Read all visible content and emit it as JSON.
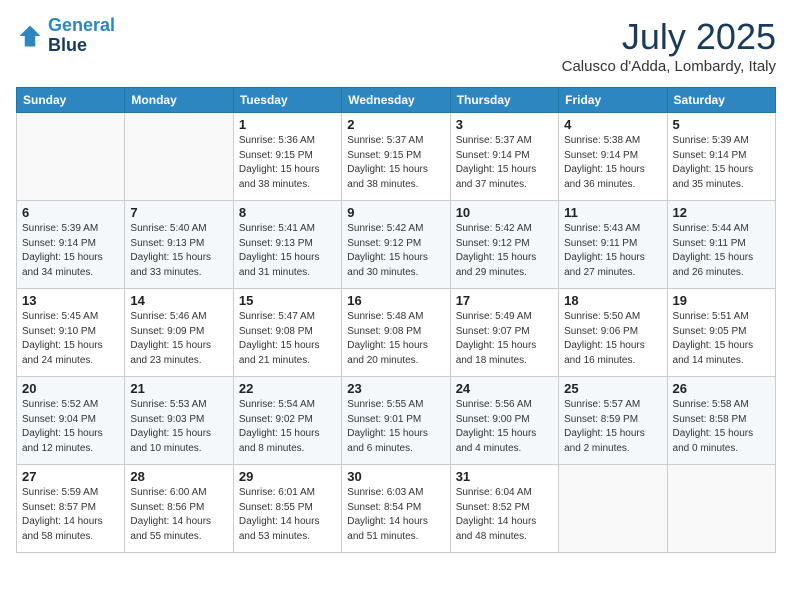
{
  "header": {
    "logo_line1": "General",
    "logo_line2": "Blue",
    "month_title": "July 2025",
    "location": "Calusco d'Adda, Lombardy, Italy"
  },
  "days_of_week": [
    "Sunday",
    "Monday",
    "Tuesday",
    "Wednesday",
    "Thursday",
    "Friday",
    "Saturday"
  ],
  "weeks": [
    [
      {
        "day": "",
        "info": ""
      },
      {
        "day": "",
        "info": ""
      },
      {
        "day": "1",
        "info": "Sunrise: 5:36 AM\nSunset: 9:15 PM\nDaylight: 15 hours\nand 38 minutes."
      },
      {
        "day": "2",
        "info": "Sunrise: 5:37 AM\nSunset: 9:15 PM\nDaylight: 15 hours\nand 38 minutes."
      },
      {
        "day": "3",
        "info": "Sunrise: 5:37 AM\nSunset: 9:14 PM\nDaylight: 15 hours\nand 37 minutes."
      },
      {
        "day": "4",
        "info": "Sunrise: 5:38 AM\nSunset: 9:14 PM\nDaylight: 15 hours\nand 36 minutes."
      },
      {
        "day": "5",
        "info": "Sunrise: 5:39 AM\nSunset: 9:14 PM\nDaylight: 15 hours\nand 35 minutes."
      }
    ],
    [
      {
        "day": "6",
        "info": "Sunrise: 5:39 AM\nSunset: 9:14 PM\nDaylight: 15 hours\nand 34 minutes."
      },
      {
        "day": "7",
        "info": "Sunrise: 5:40 AM\nSunset: 9:13 PM\nDaylight: 15 hours\nand 33 minutes."
      },
      {
        "day": "8",
        "info": "Sunrise: 5:41 AM\nSunset: 9:13 PM\nDaylight: 15 hours\nand 31 minutes."
      },
      {
        "day": "9",
        "info": "Sunrise: 5:42 AM\nSunset: 9:12 PM\nDaylight: 15 hours\nand 30 minutes."
      },
      {
        "day": "10",
        "info": "Sunrise: 5:42 AM\nSunset: 9:12 PM\nDaylight: 15 hours\nand 29 minutes."
      },
      {
        "day": "11",
        "info": "Sunrise: 5:43 AM\nSunset: 9:11 PM\nDaylight: 15 hours\nand 27 minutes."
      },
      {
        "day": "12",
        "info": "Sunrise: 5:44 AM\nSunset: 9:11 PM\nDaylight: 15 hours\nand 26 minutes."
      }
    ],
    [
      {
        "day": "13",
        "info": "Sunrise: 5:45 AM\nSunset: 9:10 PM\nDaylight: 15 hours\nand 24 minutes."
      },
      {
        "day": "14",
        "info": "Sunrise: 5:46 AM\nSunset: 9:09 PM\nDaylight: 15 hours\nand 23 minutes."
      },
      {
        "day": "15",
        "info": "Sunrise: 5:47 AM\nSunset: 9:08 PM\nDaylight: 15 hours\nand 21 minutes."
      },
      {
        "day": "16",
        "info": "Sunrise: 5:48 AM\nSunset: 9:08 PM\nDaylight: 15 hours\nand 20 minutes."
      },
      {
        "day": "17",
        "info": "Sunrise: 5:49 AM\nSunset: 9:07 PM\nDaylight: 15 hours\nand 18 minutes."
      },
      {
        "day": "18",
        "info": "Sunrise: 5:50 AM\nSunset: 9:06 PM\nDaylight: 15 hours\nand 16 minutes."
      },
      {
        "day": "19",
        "info": "Sunrise: 5:51 AM\nSunset: 9:05 PM\nDaylight: 15 hours\nand 14 minutes."
      }
    ],
    [
      {
        "day": "20",
        "info": "Sunrise: 5:52 AM\nSunset: 9:04 PM\nDaylight: 15 hours\nand 12 minutes."
      },
      {
        "day": "21",
        "info": "Sunrise: 5:53 AM\nSunset: 9:03 PM\nDaylight: 15 hours\nand 10 minutes."
      },
      {
        "day": "22",
        "info": "Sunrise: 5:54 AM\nSunset: 9:02 PM\nDaylight: 15 hours\nand 8 minutes."
      },
      {
        "day": "23",
        "info": "Sunrise: 5:55 AM\nSunset: 9:01 PM\nDaylight: 15 hours\nand 6 minutes."
      },
      {
        "day": "24",
        "info": "Sunrise: 5:56 AM\nSunset: 9:00 PM\nDaylight: 15 hours\nand 4 minutes."
      },
      {
        "day": "25",
        "info": "Sunrise: 5:57 AM\nSunset: 8:59 PM\nDaylight: 15 hours\nand 2 minutes."
      },
      {
        "day": "26",
        "info": "Sunrise: 5:58 AM\nSunset: 8:58 PM\nDaylight: 15 hours\nand 0 minutes."
      }
    ],
    [
      {
        "day": "27",
        "info": "Sunrise: 5:59 AM\nSunset: 8:57 PM\nDaylight: 14 hours\nand 58 minutes."
      },
      {
        "day": "28",
        "info": "Sunrise: 6:00 AM\nSunset: 8:56 PM\nDaylight: 14 hours\nand 55 minutes."
      },
      {
        "day": "29",
        "info": "Sunrise: 6:01 AM\nSunset: 8:55 PM\nDaylight: 14 hours\nand 53 minutes."
      },
      {
        "day": "30",
        "info": "Sunrise: 6:03 AM\nSunset: 8:54 PM\nDaylight: 14 hours\nand 51 minutes."
      },
      {
        "day": "31",
        "info": "Sunrise: 6:04 AM\nSunset: 8:52 PM\nDaylight: 14 hours\nand 48 minutes."
      },
      {
        "day": "",
        "info": ""
      },
      {
        "day": "",
        "info": ""
      }
    ]
  ]
}
